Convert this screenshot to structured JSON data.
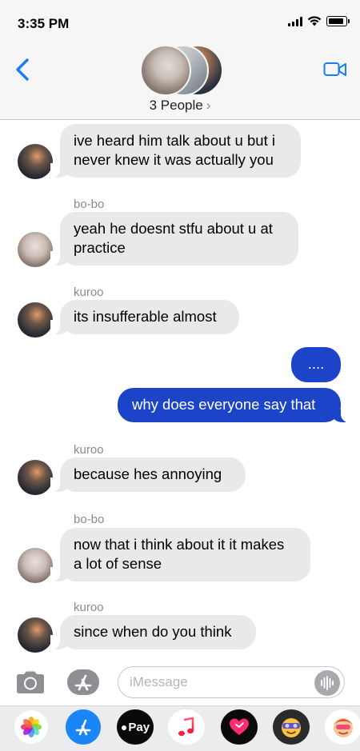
{
  "status_bar": {
    "time": "3:35 PM"
  },
  "header": {
    "people_label": "3 People",
    "chevron": "›",
    "icons": {
      "back": "chevron-left-icon",
      "video": "video-camera-icon"
    }
  },
  "messages": [
    {
      "sender": "",
      "text_lines": [
        "ive heard him talk about u but i",
        "never knew it was actually you"
      ],
      "direction": "incoming",
      "avatar": "kuroo"
    },
    {
      "sender": "bo-bo",
      "text_lines": [
        "yeah he doesnt stfu about u at",
        "practice"
      ],
      "direction": "incoming",
      "avatar": "bo-bo"
    },
    {
      "sender": "kuroo",
      "text_lines": [
        "its insufferable almost"
      ],
      "direction": "incoming",
      "avatar": "kuroo"
    },
    {
      "sender": "",
      "text_lines": [
        "...."
      ],
      "direction": "outgoing"
    },
    {
      "sender": "",
      "text_lines": [
        "why does everyone say that"
      ],
      "direction": "outgoing"
    },
    {
      "sender": "kuroo",
      "text_lines": [
        "because hes annoying"
      ],
      "direction": "incoming",
      "avatar": "kuroo"
    },
    {
      "sender": "bo-bo",
      "text_lines": [
        "now that i think about it it makes",
        "a lot of sense"
      ],
      "direction": "incoming",
      "avatar": "bo-bo"
    },
    {
      "sender": "kuroo",
      "text_lines": [
        "since when do you think"
      ],
      "direction": "incoming",
      "avatar": "kuroo"
    }
  ],
  "input": {
    "placeholder": "iMessage"
  },
  "app_drawer": {
    "pay_label": "Pay"
  },
  "colors": {
    "outgoing_bubble": "#1c44c8",
    "incoming_bubble": "#e9e9eb",
    "ios_blue": "#1a7cf5"
  }
}
